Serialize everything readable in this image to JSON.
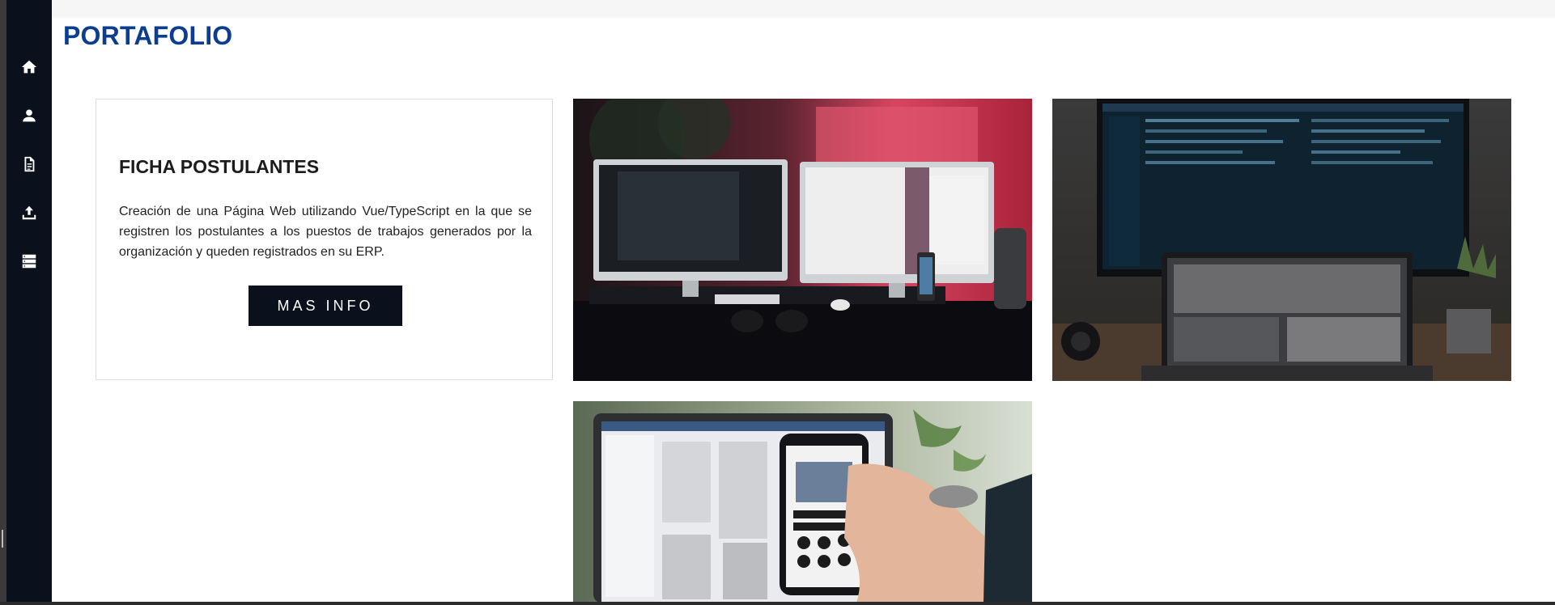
{
  "page": {
    "title": "PORTAFOLIO"
  },
  "sidebar": {
    "items": [
      {
        "icon": "home-icon"
      },
      {
        "icon": "user-icon"
      },
      {
        "icon": "document-icon"
      },
      {
        "icon": "upload-icon"
      },
      {
        "icon": "server-icon"
      }
    ]
  },
  "portfolio": {
    "card": {
      "title": "FICHA POSTULANTES",
      "description": "Creación de una Página Web utilizando Vue/TypeScript en la que se registren los postulantes a los puestos de trabajos generados por la organización y queden registrados en su ERP.",
      "button_label": "MAS INFO"
    }
  },
  "colors": {
    "title": "#0b3d91",
    "sidebar": "#0a111c",
    "button": "#0a111c"
  }
}
